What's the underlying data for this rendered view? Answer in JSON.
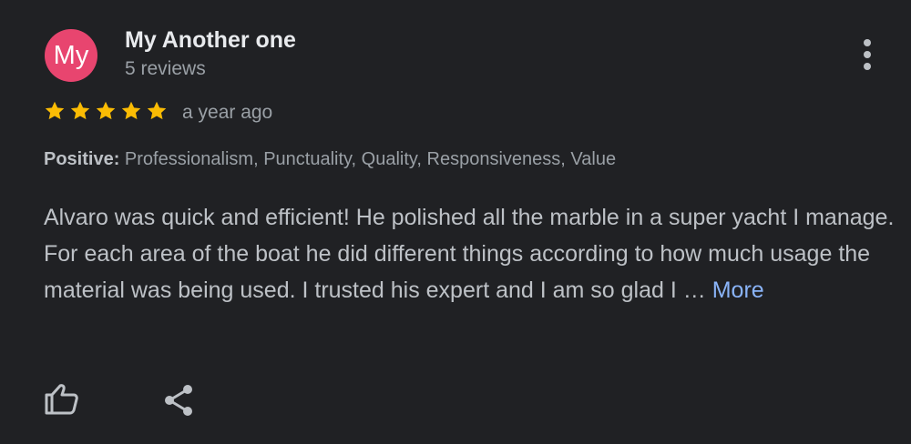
{
  "review": {
    "avatar_initials": "My",
    "avatar_color": "#e8456f",
    "author": "My Another one",
    "reviews_count": "5 reviews",
    "rating": 5,
    "rating_max": 5,
    "star_color": "#fbbc04",
    "time": "a year ago",
    "positive_label": "Positive:",
    "positive_values": "Professionalism, Punctuality, Quality, Responsiveness, Value",
    "text": "Alvaro was quick and efficient! He polished all the marble in a super yacht I manage. For each area of the boat he did different things according to how much usage the material was being used. I trusted his expert and I am so glad I …",
    "more_label": "More"
  },
  "actions": {
    "like_icon": "thumb-up-icon",
    "share_icon": "share-icon",
    "menu_icon": "more-vert-icon"
  },
  "colors": {
    "background": "#202124",
    "link": "#8ab4f8"
  }
}
